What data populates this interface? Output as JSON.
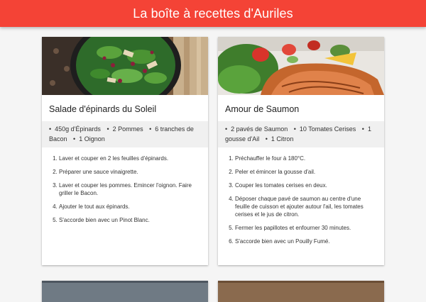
{
  "header": {
    "title": "La boîte à recettes d'Auriles",
    "background_color": "#f44336"
  },
  "recipes": [
    {
      "title": "Salade d'épinards du Soleil",
      "image": "spinach-salad-photo",
      "ingredients": [
        "450g d'Épinards",
        "2 Pommes",
        "6 tranches de Bacon",
        "1 Oignon"
      ],
      "steps": [
        "Laver et couper en 2 les feuilles d'épinards.",
        "Préparer une sauce vinaigrette.",
        "Laver et couper les pommes. Emincer l'oignon. Faire griller le Bacon.",
        "Ajouter le tout aux épinards.",
        "S'accorde bien avec un Pinot Blanc."
      ]
    },
    {
      "title": "Amour de Saumon",
      "image": "salmon-dish-photo",
      "ingredients": [
        "2 pavés de Saumon",
        "10 Tomates Cerises",
        "1 gousse d'Ail",
        "1 Citron"
      ],
      "steps": [
        "Préchauffer le four à 180°C.",
        "Peler et émincer la gousse d'ail.",
        "Couper les tomates cerises en deux.",
        "Déposer chaque pavé de saumon au centre d'une feuille de cuisson et ajouter autour l'ail, les tomates cerises et le jus de citron.",
        "Fermer les papillotes et enfourner 30 minutes.",
        "S'accorde bien avec un Pouilly Fumé."
      ]
    }
  ]
}
